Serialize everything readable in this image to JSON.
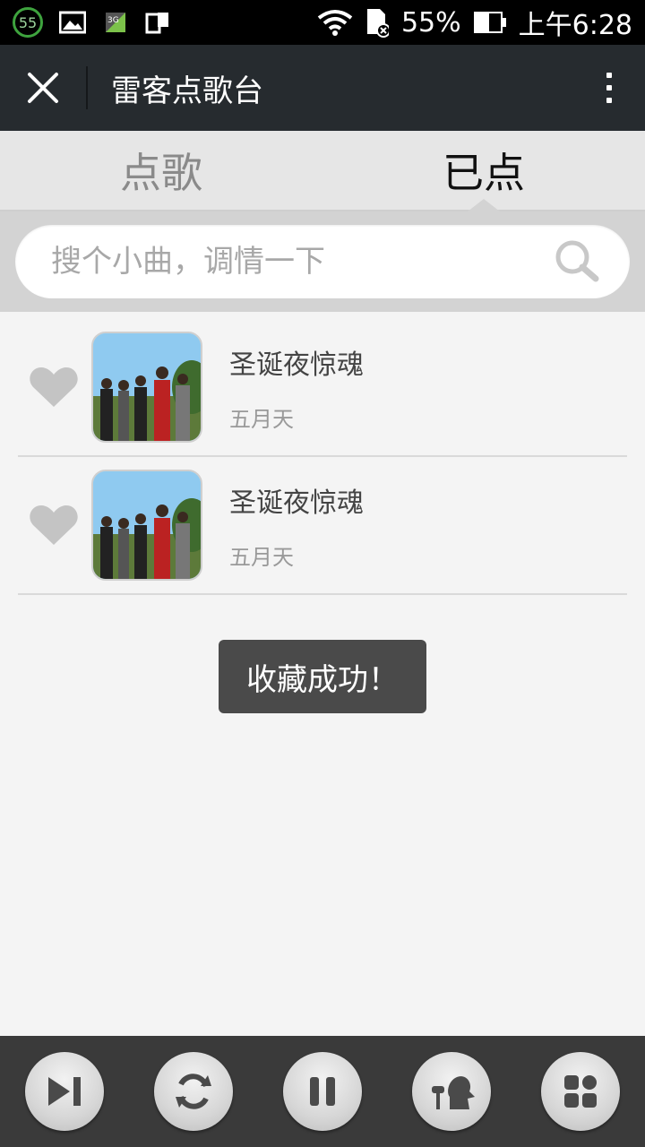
{
  "status_bar": {
    "badge": "55",
    "battery_percent": "55%",
    "battery_level": 0.55,
    "time": "上午6:28"
  },
  "header": {
    "title": "雷客点歌台"
  },
  "tabs": [
    {
      "label": "点歌",
      "active": false
    },
    {
      "label": "已点",
      "active": true
    }
  ],
  "search": {
    "placeholder": "搜个小曲，调情一下"
  },
  "songs": [
    {
      "title": "圣诞夜惊魂",
      "artist": "五月天"
    },
    {
      "title": "圣诞夜惊魂",
      "artist": "五月天"
    }
  ],
  "toast": {
    "message": "收藏成功！"
  },
  "controls": [
    {
      "icon": "skip-next-icon"
    },
    {
      "icon": "repeat-icon"
    },
    {
      "icon": "pause-icon"
    },
    {
      "icon": "microphone-person-icon"
    },
    {
      "icon": "apps-grid-icon"
    }
  ],
  "colors": {
    "header_bg": "#262b2f",
    "tab_bg": "#e6e6e6",
    "search_bg": "#d3d3d3",
    "list_bg": "#f4f4f4",
    "toast_bg": "#4a4a4a",
    "bottom_bar_bg": "#3a3a3a"
  }
}
